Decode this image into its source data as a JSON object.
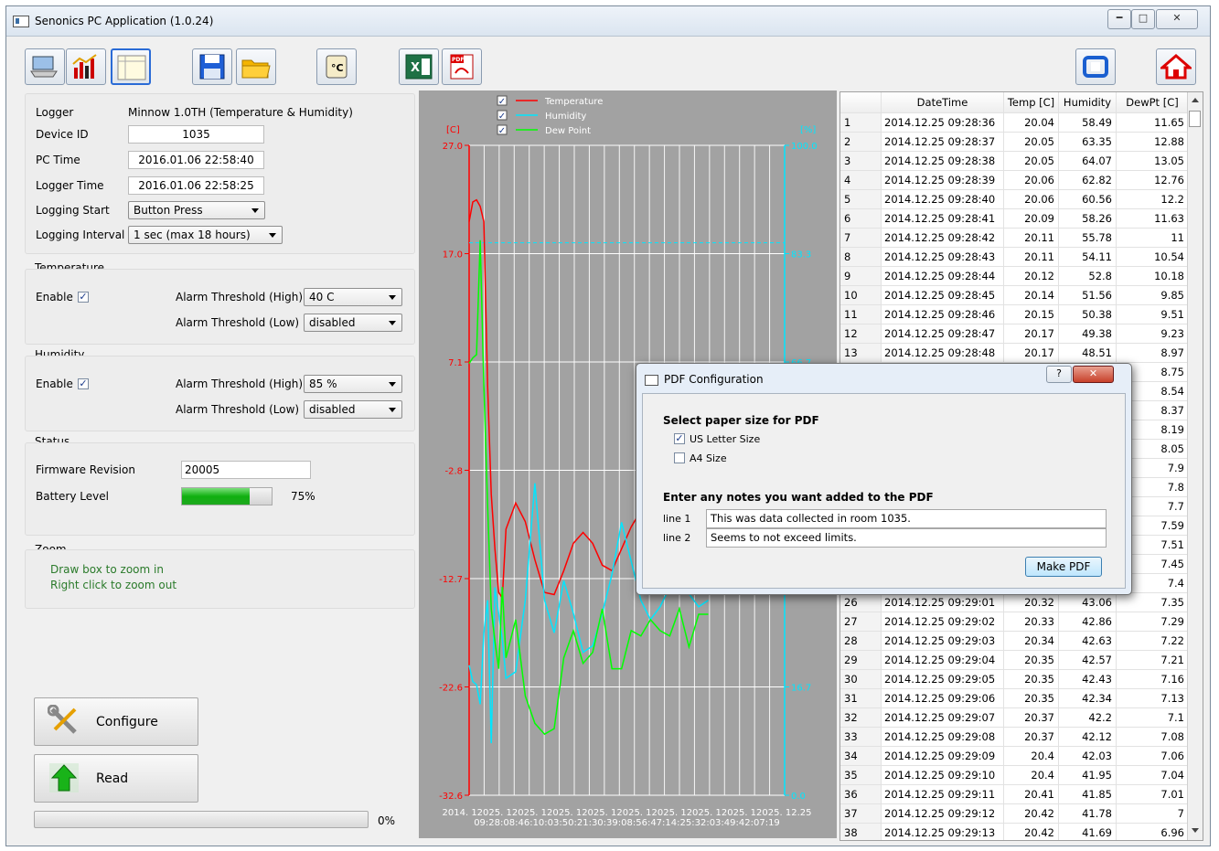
{
  "window": {
    "title": "Senonics PC Application (1.0.24)"
  },
  "logger": {
    "logger_label": "Logger",
    "logger_value": "Minnow 1.0TH (Temperature & Humidity)",
    "device_id_label": "Device ID",
    "device_id": "1035",
    "pc_time_label": "PC Time",
    "pc_time": "2016.01.06 22:58:40",
    "logger_time_label": "Logger Time",
    "logger_time": "2016.01.06 22:58:25",
    "logging_start_label": "Logging Start",
    "logging_start": "Button Press",
    "logging_interval_label": "Logging Interval",
    "logging_interval": "1 sec (max 18 hours)"
  },
  "temperature": {
    "title": "Temperature",
    "enable_label": "Enable",
    "high_label": "Alarm Threshold (High)",
    "high_value": "40 C",
    "low_label": "Alarm Threshold (Low)",
    "low_value": "disabled"
  },
  "humidity": {
    "title": "Humidity",
    "enable_label": "Enable",
    "high_label": "Alarm Threshold (High)",
    "high_value": "85 %",
    "low_label": "Alarm Threshold (Low)",
    "low_value": "disabled"
  },
  "status": {
    "title": "Status",
    "firmware_label": "Firmware Revision",
    "firmware": "20005",
    "battery_label": "Battery Level",
    "battery_percent": "75%",
    "battery_level": 0.75
  },
  "zoom": {
    "title": "Zoom",
    "line1": "Draw box to zoom in",
    "line2": "Right click to zoom out"
  },
  "buttons": {
    "configure": "Configure",
    "read": "Read"
  },
  "progress": {
    "percent": "0%",
    "value": 0
  },
  "chart_data": {
    "type": "line",
    "legend": [
      "Temperature",
      "Humidity",
      "Dew Point"
    ],
    "colors": {
      "Temperature": "#ff0000",
      "Humidity": "#00e6ff",
      "Dew Point": "#00ff00"
    },
    "left_unit": "[C]",
    "right_unit": "[%]",
    "left_ticks": [
      "27.0",
      "17.0",
      "7.1",
      "-2.8",
      "-12.7",
      "-22.6",
      "-32.6"
    ],
    "right_ticks": [
      "100.0",
      "83.3",
      "66.7",
      "50.0",
      "33.3",
      "16.7",
      "0.0"
    ],
    "x_ticks_line1": "2014. 12025. 12025. 12025. 12025. 12025. 12025. 12025. 12025. 12025. 12.25",
    "x_ticks_line2": "09:28:08:46:10:03:50:21:30:39:08:56:47:14:25:32:03:49:42:07:19",
    "ylim_left": [
      -32.6,
      27.0
    ],
    "ylim_right": [
      0,
      100
    ],
    "dashed_humidity_limit": 85,
    "series": [
      {
        "name": "Temperature",
        "axis": "left",
        "values": [
          20.0,
          21.8,
          22.0,
          21.4,
          20.0,
          5.0,
          -5.0,
          -10.0,
          -14.0,
          -14.5,
          -8.2,
          -5.8,
          -7.5,
          -11.0,
          -14.0,
          -14.2,
          -12.0,
          -9.5,
          -8.5,
          -9.5,
          -11.5,
          -12.0,
          -10.0,
          -8.0,
          -6.5,
          -7.5,
          -9.0,
          -11.0,
          -12.5,
          -11.5,
          -10.0,
          -8.5
        ]
      },
      {
        "name": "Humidity",
        "axis": "right",
        "values": [
          20.0,
          17.5,
          17.0,
          14.0,
          25.0,
          30.0,
          8.0,
          32.0,
          28.0,
          24.0,
          18.0,
          19.0,
          30.0,
          48.0,
          30.0,
          25.0,
          33.0,
          28.0,
          22.0,
          23.0,
          28.0,
          34.0,
          42.0,
          36.0,
          30.0,
          27.0,
          29.0,
          32.0,
          35.0,
          31.0,
          29.0,
          30.0
        ]
      },
      {
        "name": "Dew Point",
        "axis": "left",
        "values": [
          7.0,
          7.5,
          7.8,
          18.3,
          5.0,
          -6.0,
          -15.5,
          -18.5,
          -21.0,
          -13.5,
          -20.0,
          -16.5,
          -23.5,
          -26.0,
          -27.0,
          -26.5,
          -20.0,
          -17.5,
          -20.5,
          -19.5,
          -15.5,
          -21.0,
          -21.0,
          -17.5,
          -18.0,
          -16.5,
          -17.5,
          -18.0,
          -15.5,
          -19.0,
          -16.0,
          -16.0
        ]
      }
    ]
  },
  "table": {
    "headers": [
      "DateTime",
      "Temp [C]",
      "Humidity",
      "DewPt [C]"
    ],
    "rows": [
      [
        "1",
        "2014.12.25  09:28:36",
        "20.04",
        "58.49",
        "11.65"
      ],
      [
        "2",
        "2014.12.25  09:28:37",
        "20.05",
        "63.35",
        "12.88"
      ],
      [
        "3",
        "2014.12.25  09:28:38",
        "20.05",
        "64.07",
        "13.05"
      ],
      [
        "4",
        "2014.12.25  09:28:39",
        "20.06",
        "62.82",
        "12.76"
      ],
      [
        "5",
        "2014.12.25  09:28:40",
        "20.06",
        "60.56",
        "12.2"
      ],
      [
        "6",
        "2014.12.25  09:28:41",
        "20.09",
        "58.26",
        "11.63"
      ],
      [
        "7",
        "2014.12.25  09:28:42",
        "20.11",
        "55.78",
        "11"
      ],
      [
        "8",
        "2014.12.25  09:28:43",
        "20.11",
        "54.11",
        "10.54"
      ],
      [
        "9",
        "2014.12.25  09:28:44",
        "20.12",
        "52.8",
        "10.18"
      ],
      [
        "10",
        "2014.12.25  09:28:45",
        "20.14",
        "51.56",
        "9.85"
      ],
      [
        "11",
        "2014.12.25  09:28:46",
        "20.15",
        "50.38",
        "9.51"
      ],
      [
        "12",
        "2014.12.25  09:28:47",
        "20.17",
        "49.38",
        "9.23"
      ],
      [
        "13",
        "2014.12.25  09:28:48",
        "20.17",
        "48.51",
        "8.97"
      ],
      [
        "14",
        "",
        "",
        "",
        "8.75"
      ],
      [
        "15",
        "",
        "",
        "",
        "8.54"
      ],
      [
        "16",
        "",
        "",
        "",
        "8.37"
      ],
      [
        "17",
        "",
        "",
        "",
        "8.19"
      ],
      [
        "18",
        "",
        "",
        "",
        "8.05"
      ],
      [
        "19",
        "",
        "",
        "",
        "7.9"
      ],
      [
        "20",
        "",
        "",
        "",
        "7.8"
      ],
      [
        "21",
        "",
        "",
        "",
        "7.7"
      ],
      [
        "22",
        "",
        "",
        "",
        "7.59"
      ],
      [
        "23",
        "",
        "",
        "",
        "7.51"
      ],
      [
        "24",
        "",
        "",
        "",
        "7.45"
      ],
      [
        "25",
        "",
        "",
        "",
        "7.4"
      ],
      [
        "26",
        "2014.12.25  09:29:01",
        "20.32",
        "43.06",
        "7.35"
      ],
      [
        "27",
        "2014.12.25  09:29:02",
        "20.33",
        "42.86",
        "7.29"
      ],
      [
        "28",
        "2014.12.25  09:29:03",
        "20.34",
        "42.63",
        "7.22"
      ],
      [
        "29",
        "2014.12.25  09:29:04",
        "20.35",
        "42.57",
        "7.21"
      ],
      [
        "30",
        "2014.12.25  09:29:05",
        "20.35",
        "42.43",
        "7.16"
      ],
      [
        "31",
        "2014.12.25  09:29:06",
        "20.35",
        "42.34",
        "7.13"
      ],
      [
        "32",
        "2014.12.25  09:29:07",
        "20.37",
        "42.2",
        "7.1"
      ],
      [
        "33",
        "2014.12.25  09:29:08",
        "20.37",
        "42.12",
        "7.08"
      ],
      [
        "34",
        "2014.12.25  09:29:09",
        "20.4",
        "42.03",
        "7.06"
      ],
      [
        "35",
        "2014.12.25  09:29:10",
        "20.4",
        "41.95",
        "7.04"
      ],
      [
        "36",
        "2014.12.25  09:29:11",
        "20.41",
        "41.85",
        "7.01"
      ],
      [
        "37",
        "2014.12.25  09:29:12",
        "20.42",
        "41.78",
        "7"
      ],
      [
        "38",
        "2014.12.25  09:29:13",
        "20.42",
        "41.69",
        "6.96"
      ]
    ]
  },
  "dialog": {
    "title": "PDF Configuration",
    "paper_heading": "Select paper size for PDF",
    "us_letter": "US Letter Size",
    "us_letter_checked": true,
    "a4": "A4 Size",
    "a4_checked": false,
    "notes_heading": "Enter any notes you want added to the PDF",
    "line1_label": "line 1",
    "line1_value": "This was data collected in room 1035.",
    "line2_label": "line 2",
    "line2_value": "Seems to not exceed limits.",
    "make_pdf": "Make PDF"
  }
}
